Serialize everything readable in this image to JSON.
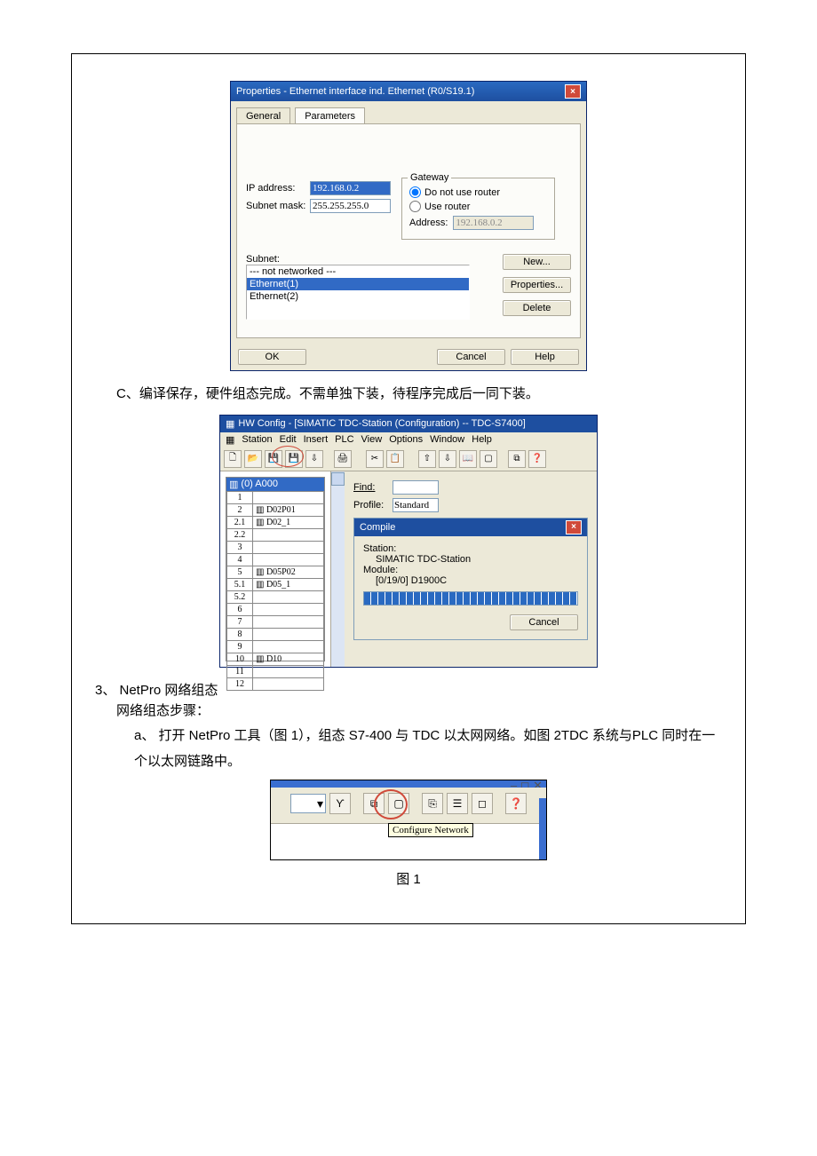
{
  "dlg1": {
    "title": "Properties - Ethernet interface  ind. Ethernet (R0/S19.1)",
    "tab_general": "General",
    "tab_params": "Parameters",
    "ip_label": "IP address:",
    "ip_value": "192.168.0.2",
    "sm_label": "Subnet mask:",
    "sm_value": "255.255.255.0",
    "gw_title": "Gateway",
    "gw_opt1": "Do not use router",
    "gw_opt2": "Use router",
    "gw_addr_label": "Address:",
    "gw_addr_value": "192.168.0.2",
    "subnet_label": "Subnet:",
    "subnet_items": [
      "--- not networked ---",
      "Ethernet(1)",
      "Ethernet(2)"
    ],
    "btn_new": "New...",
    "btn_prop": "Properties...",
    "btn_del": "Delete",
    "btn_ok": "OK",
    "btn_cancel": "Cancel",
    "btn_help": "Help"
  },
  "line_c": "C、编译保存，硬件组态完成。不需单独下装，待程序完成后一同下装。",
  "hw": {
    "title": "HW Config - [SIMATIC TDC-Station (Configuration) -- TDC-S7400]",
    "menu": [
      "Station",
      "Edit",
      "Insert",
      "PLC",
      "View",
      "Options",
      "Window",
      "Help"
    ],
    "rack_head": "(0) A000",
    "rows": [
      {
        "n": "1",
        "v": ""
      },
      {
        "n": "2",
        "v": "D02P01",
        "b": true
      },
      {
        "n": "2.1",
        "v": "D02_1"
      },
      {
        "n": "2.2",
        "v": ""
      },
      {
        "n": "3",
        "v": ""
      },
      {
        "n": "4",
        "v": ""
      },
      {
        "n": "5",
        "v": "D05P02",
        "b": true
      },
      {
        "n": "5.1",
        "v": "D05_1"
      },
      {
        "n": "5.2",
        "v": ""
      },
      {
        "n": "6",
        "v": ""
      },
      {
        "n": "7",
        "v": ""
      },
      {
        "n": "8",
        "v": ""
      },
      {
        "n": "9",
        "v": ""
      },
      {
        "n": "10",
        "v": "D10"
      },
      {
        "n": "11",
        "v": ""
      },
      {
        "n": "12",
        "v": ""
      }
    ],
    "find": "Find:",
    "profile": "Profile:",
    "profile_val": "Standard",
    "compile_title": "Compile",
    "station_lbl": "Station:",
    "station_val": "SIMATIC TDC-Station",
    "module_lbl": "Module:",
    "module_val": "[0/19/0] D1900C",
    "cancel": "Cancel"
  },
  "sec3_head": "3、 NetPro 网络组态",
  "sec3_sub": "网络组态步骤：",
  "sec3_a": "a、 打开 NetPro 工具（图 1），组态 S7-400 与 TDC 以太网网络。如图 2TDC 系统与PLC 同时在一个以太网链路中。",
  "np": {
    "tooltip": "Configure Network",
    "win_ctrls": "– ◻ ✕",
    "caption": "图 1"
  }
}
